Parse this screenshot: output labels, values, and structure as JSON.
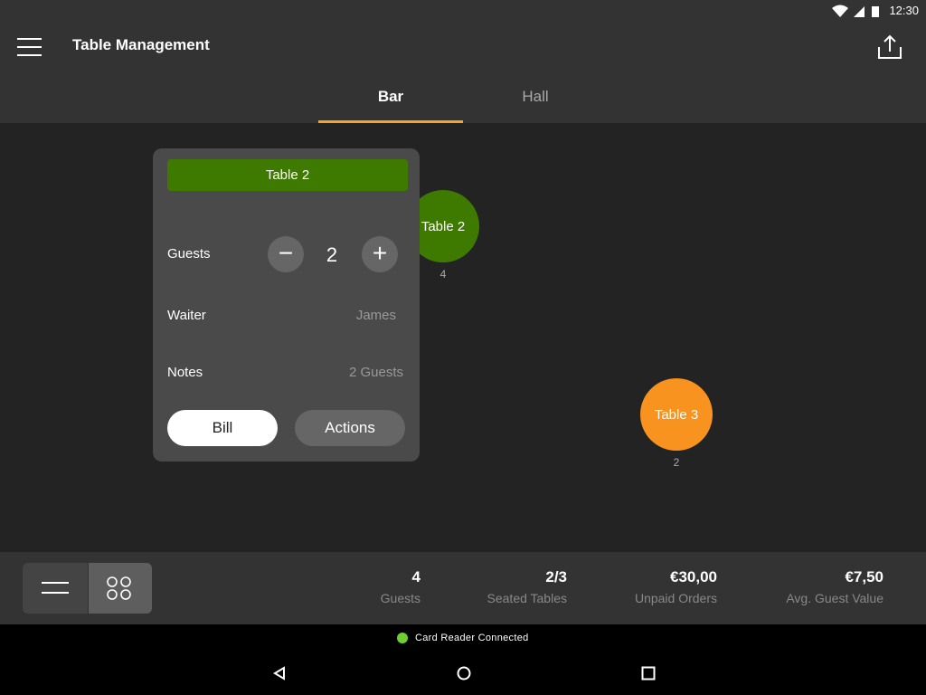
{
  "status_bar": {
    "time": "12:30",
    "icons": [
      "wifi-icon",
      "signal-icon",
      "battery-icon"
    ]
  },
  "app_bar": {
    "title": "Table Management",
    "menu_icon": "hamburger-icon",
    "share_icon": "upload-icon"
  },
  "tabs": [
    {
      "label": "Bar",
      "active": true
    },
    {
      "label": "Hall",
      "active": false
    }
  ],
  "tables": [
    {
      "name": "Table 2",
      "seats": "4",
      "color": "#3f7a00"
    },
    {
      "name": "Table 3",
      "seats": "2",
      "color": "#f7931e"
    }
  ],
  "popup": {
    "title": "Table 2",
    "guests_label": "Guests",
    "guests_value": "2",
    "waiter_label": "Waiter",
    "waiter_value": "James",
    "notes_label": "Notes",
    "notes_value": "2 Guests",
    "bill_label": "Bill",
    "actions_label": "Actions"
  },
  "bottom": {
    "stats": [
      {
        "value": "4",
        "label": "Guests"
      },
      {
        "value": "2/3",
        "label": "Seated Tables"
      },
      {
        "value": "€30,00",
        "label": "Unpaid Orders"
      },
      {
        "value": "€7,50",
        "label": "Avg. Guest Value"
      }
    ],
    "view_toggle": {
      "active": "grid"
    }
  },
  "card_reader": {
    "text": "Card Reader Connected",
    "color": "#6fcf2f"
  }
}
